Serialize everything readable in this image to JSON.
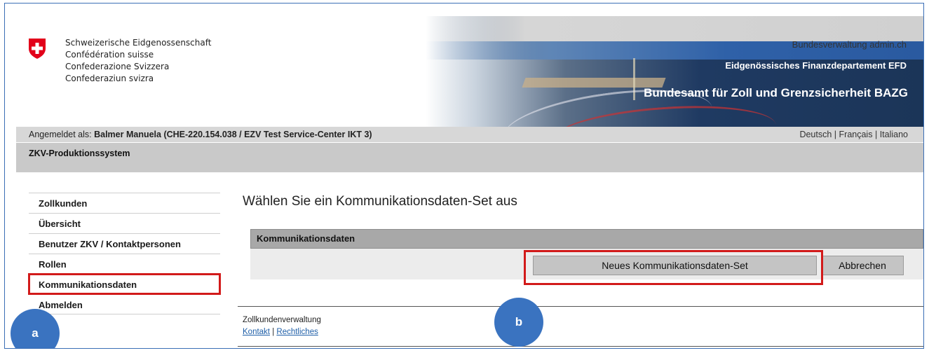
{
  "header": {
    "gov_names": [
      "Schweizerische Eidgenossenschaft",
      "Confédération suisse",
      "Confederazione Svizzera",
      "Confederaziun svizra"
    ],
    "admin_link": "Bundesverwaltung admin.ch",
    "department": "Eidgenössisches Finanzdepartement EFD",
    "office": "Bundesamt für Zoll und Grenzsicherheit BAZG"
  },
  "userbar": {
    "logged_in_label": "Angemeldet als: ",
    "logged_in_user": "Balmer Manuela (CHE-220.154.038 / EZV Test Service-Center IKT 3)",
    "languages": [
      "Deutsch",
      "Français",
      "Italiano"
    ],
    "separator": "|"
  },
  "system": {
    "name": "ZKV-Produktionssystem"
  },
  "sidebar": {
    "items": [
      {
        "label": "Zollkunden"
      },
      {
        "label": "Übersicht"
      },
      {
        "label": "Benutzer ZKV / Kontaktpersonen"
      },
      {
        "label": "Rollen"
      },
      {
        "label": "Kommunikationsdaten",
        "active": true
      },
      {
        "label": "Abmelden"
      }
    ]
  },
  "main": {
    "title": "Wählen Sie ein Kommunikationsdaten-Set aus",
    "panel_header": "Kommunikationsdaten",
    "new_button": "Neues Kommunikationsdaten-Set",
    "cancel_button": "Abbrechen"
  },
  "footer": {
    "org": "Zollkundenverwaltung",
    "links": [
      "Kontakt",
      "Rechtliches"
    ]
  },
  "annotations": {
    "marker_a": "a",
    "marker_b": "b"
  },
  "colors": {
    "highlight": "#d21a1a",
    "marker": "#3a73c0",
    "swiss_red": "#e2001a"
  }
}
